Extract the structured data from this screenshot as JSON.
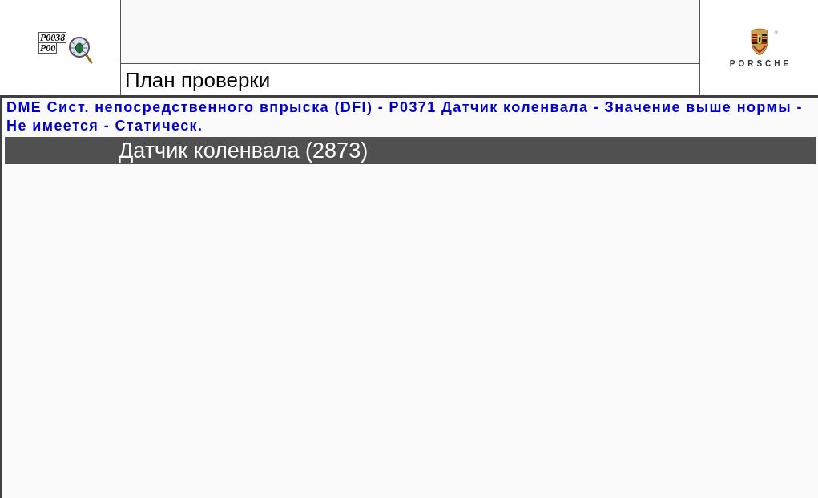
{
  "header": {
    "app_icon": {
      "codes": [
        "P0038",
        "P00"
      ]
    },
    "title": "План проверки",
    "logo": {
      "mark": "®",
      "wordmark": "PORSCHE"
    }
  },
  "fault": {
    "description": "DME Сист. непосредственного впрыска (DFI) - P0371 Датчик коленвала - Значение выше нормы - Не имеется - Статическ."
  },
  "sections": [
    {
      "title": "Датчик коленвала (2873)"
    }
  ]
}
